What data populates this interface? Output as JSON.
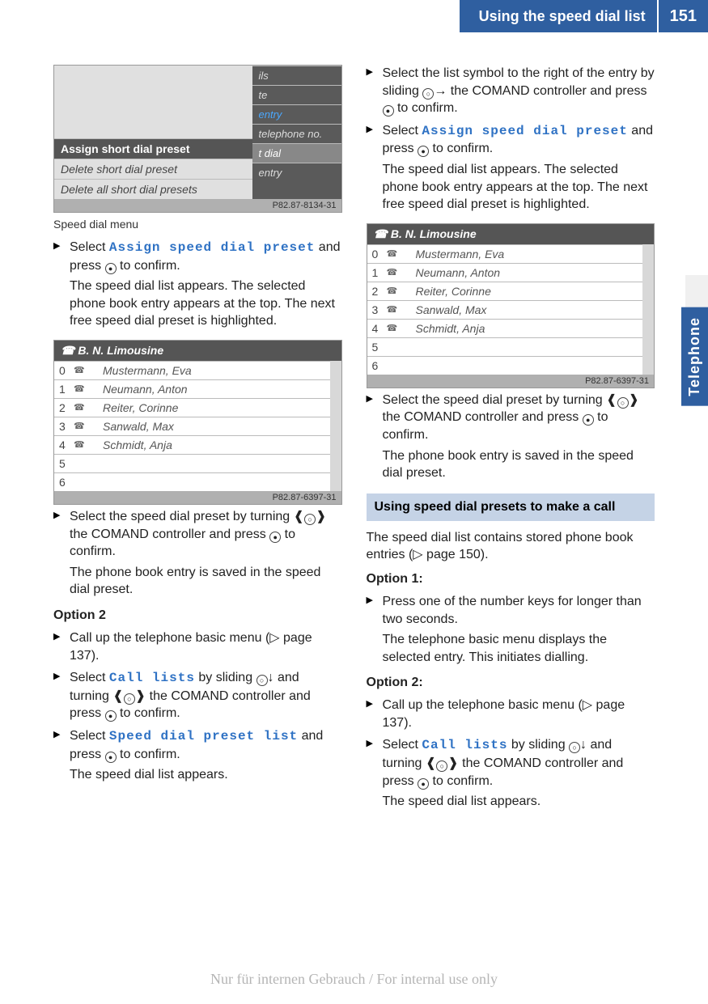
{
  "header": {
    "title": "Using the speed dial list",
    "page": "151"
  },
  "side_tab": "Telephone",
  "left": {
    "ss1": {
      "menu_rows": [
        "Assign short dial preset",
        "Delete short dial preset",
        "Delete all short dial presets"
      ],
      "right_rows": [
        "ils",
        "te",
        "entry",
        "telephone no.",
        "t dial",
        "entry"
      ],
      "footer": "P82.87-8134-31",
      "caption": "Speed dial menu"
    },
    "step1_a": "Select ",
    "step1_menu": "Assign speed dial preset",
    "step1_b": " and press ",
    "step1_c": " to confirm.",
    "step1_follow": "The speed dial list appears. The selected phone book entry appears at the top. The next free speed dial preset is highlighted.",
    "ss2": {
      "header": "B. N. Limousine",
      "rows": [
        {
          "n": "0",
          "name": "Mustermann, Eva"
        },
        {
          "n": "1",
          "name": "Neumann, Anton"
        },
        {
          "n": "2",
          "name": "Reiter, Corinne"
        },
        {
          "n": "3",
          "name": "Sanwald, Max"
        },
        {
          "n": "4",
          "name": "Schmidt, Anja"
        },
        {
          "n": "5",
          "name": ""
        },
        {
          "n": "6",
          "name": ""
        }
      ],
      "footer": "P82.87-6397-31"
    },
    "step2_a": "Select the speed dial preset by turning ",
    "step2_b": " the COMAND controller and press ",
    "step2_c": " to confirm.",
    "step2_follow": "The phone book entry is saved in the speed dial preset.",
    "option2_head": "Option 2",
    "opt2_s1_a": "Call up the telephone basic menu (",
    "opt2_s1_b": " page 137).",
    "opt2_s2_a": "Select ",
    "opt2_s2_menu": "Call lists",
    "opt2_s2_b": " by sliding ",
    "opt2_s2_c": " and turning ",
    "opt2_s2_d": " the COMAND controller and press ",
    "opt2_s2_e": " to confirm.",
    "opt2_s3_a": "Select ",
    "opt2_s3_menu": "Speed dial preset list",
    "opt2_s3_b": " and press ",
    "opt2_s3_c": " to confirm.",
    "opt2_s3_follow": "The speed dial list appears."
  },
  "right": {
    "r1_a": "Select the list symbol to the right of the entry by sliding ",
    "r1_b": " the COMAND controller and press ",
    "r1_c": " to confirm.",
    "r2_a": "Select ",
    "r2_menu": "Assign speed dial preset",
    "r2_b": " and press ",
    "r2_c": " to confirm.",
    "r2_follow": "The speed dial list appears. The selected phone book entry appears at the top. The next free speed dial preset is highlighted.",
    "ss2": {
      "header": "B. N. Limousine",
      "rows": [
        {
          "n": "0",
          "name": "Mustermann, Eva"
        },
        {
          "n": "1",
          "name": "Neumann, Anton"
        },
        {
          "n": "2",
          "name": "Reiter, Corinne"
        },
        {
          "n": "3",
          "name": "Sanwald, Max"
        },
        {
          "n": "4",
          "name": "Schmidt, Anja"
        },
        {
          "n": "5",
          "name": ""
        },
        {
          "n": "6",
          "name": ""
        }
      ],
      "footer": "P82.87-6397-31"
    },
    "r3_a": "Select the speed dial preset by turning ",
    "r3_b": " the COMAND controller and press ",
    "r3_c": " to confirm.",
    "r3_follow": "The phone book entry is saved in the speed dial preset.",
    "section": "Using speed dial presets to make a call",
    "intro_a": "The speed dial list contains stored phone book entries (",
    "intro_b": " page 150).",
    "opt1_head": "Option 1:",
    "opt1_s1": "Press one of the number keys for longer than two seconds.",
    "opt1_follow": "The telephone basic menu displays the selected entry. This initiates dialling.",
    "opt2_head": "Option 2:",
    "opt2_s1_a": "Call up the telephone basic menu (",
    "opt2_s1_b": " page 137).",
    "opt2_s2_a": "Select ",
    "opt2_s2_menu": "Call lists",
    "opt2_s2_b": " by sliding ",
    "opt2_s2_c": " and turning ",
    "opt2_s2_d": " the COMAND controller and press ",
    "opt2_s2_e": " to confirm.",
    "opt2_s2_follow": "The speed dial list appears."
  },
  "watermark": "Nur für internen Gebrauch / For internal use only"
}
